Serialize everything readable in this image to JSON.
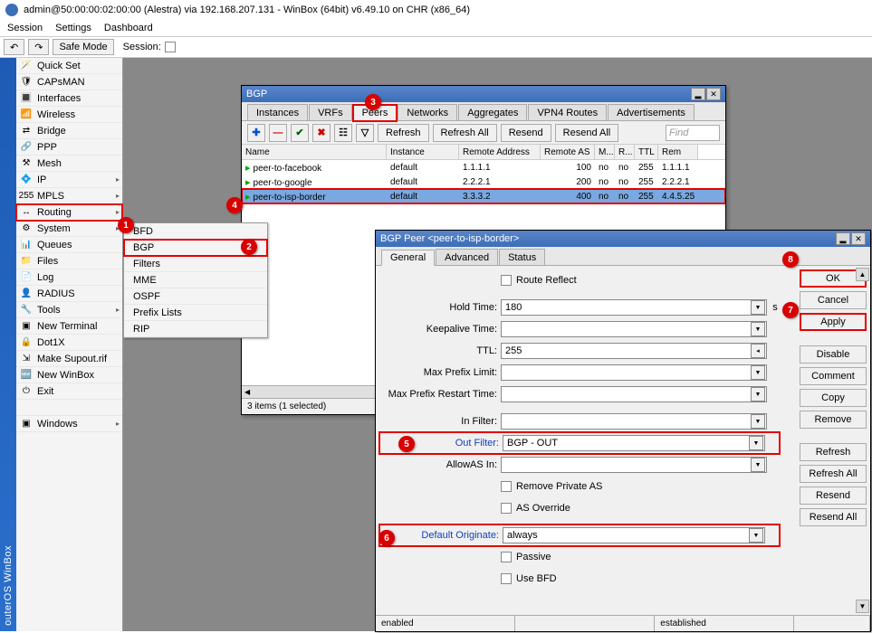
{
  "title": "admin@50:00:00:02:00:00 (Alestra) via 192.168.207.131 - WinBox (64bit) v6.49.10 on CHR (x86_64)",
  "menu": {
    "session": "Session",
    "settings": "Settings",
    "dashboard": "Dashboard"
  },
  "tb": {
    "safe": "Safe Mode",
    "session_lbl": "Session:"
  },
  "leftstrip": "outerOS  WinBox",
  "sidebar": [
    {
      "i": "🪄",
      "l": "Quick Set",
      "a": 0
    },
    {
      "i": "🛡",
      "l": "CAPsMAN",
      "a": 0
    },
    {
      "i": "🔳",
      "l": "Interfaces",
      "a": 0
    },
    {
      "i": "📶",
      "l": "Wireless",
      "a": 0
    },
    {
      "i": "⇄",
      "l": "Bridge",
      "a": 0
    },
    {
      "i": "🔗",
      "l": "PPP",
      "a": 0
    },
    {
      "i": "⚒",
      "l": "Mesh",
      "a": 0
    },
    {
      "i": "💠",
      "l": "IP",
      "a": 1
    },
    {
      "i": "255",
      "l": "MPLS",
      "a": 1
    },
    {
      "i": "↔",
      "l": "Routing",
      "a": 1,
      "hl": 1
    },
    {
      "i": "⚙",
      "l": "System",
      "a": 1
    },
    {
      "i": "📊",
      "l": "Queues",
      "a": 0
    },
    {
      "i": "📁",
      "l": "Files",
      "a": 0
    },
    {
      "i": "📄",
      "l": "Log",
      "a": 0
    },
    {
      "i": "👤",
      "l": "RADIUS",
      "a": 0
    },
    {
      "i": "🔧",
      "l": "Tools",
      "a": 1
    },
    {
      "i": "▣",
      "l": "New Terminal",
      "a": 0
    },
    {
      "i": "🔒",
      "l": "Dot1X",
      "a": 0
    },
    {
      "i": "⇲",
      "l": "Make Supout.rif",
      "a": 0
    },
    {
      "i": "🆕",
      "l": "New WinBox",
      "a": 0
    },
    {
      "i": "⏻",
      "l": "Exit",
      "a": 0
    },
    {
      "i": "",
      "l": "",
      "a": 0
    },
    {
      "i": "▣",
      "l": "Windows",
      "a": 1
    }
  ],
  "submenu": [
    {
      "l": "BFD"
    },
    {
      "l": "BGP",
      "hl": 1
    },
    {
      "l": "Filters"
    },
    {
      "l": "MME"
    },
    {
      "l": "OSPF"
    },
    {
      "l": "Prefix Lists"
    },
    {
      "l": "RIP"
    }
  ],
  "bgp": {
    "title": "BGP",
    "tabs": [
      "Instances",
      "VRFs",
      "Peers",
      "Networks",
      "Aggregates",
      "VPN4 Routes",
      "Advertisements"
    ],
    "active_tab": 2,
    "tb": {
      "refresh": "Refresh",
      "refresh_all": "Refresh All",
      "resend": "Resend",
      "resend_all": "Resend All"
    },
    "find": "Find",
    "cols": [
      "Name",
      "Instance",
      "Remote Address",
      "Remote AS",
      "M...",
      "R...",
      "TTL",
      "Rem"
    ],
    "cw": [
      160,
      80,
      90,
      60,
      22,
      22,
      26,
      44
    ],
    "rows": [
      {
        "c": [
          "peer-to-facebook",
          "default",
          "1.1.1.1",
          "100",
          "no",
          "no",
          "255",
          "1.1.1.1"
        ]
      },
      {
        "c": [
          "peer-to-google",
          "default",
          "2.2.2.1",
          "200",
          "no",
          "no",
          "255",
          "2.2.2.1"
        ]
      },
      {
        "c": [
          "peer-to-isp-border",
          "default",
          "3.3.3.2",
          "400",
          "no",
          "no",
          "255",
          "4.4.5.25"
        ],
        "sel": 1,
        "hl": 1
      }
    ],
    "status": "3 items (1 selected)"
  },
  "peer": {
    "title": "BGP Peer <peer-to-isp-border>",
    "tabs": [
      "General",
      "Advanced",
      "Status"
    ],
    "active_tab": 0,
    "fields": {
      "route_reflect": "Route Reflect",
      "hold_time_lbl": "Hold Time:",
      "hold_time": "180",
      "hold_unit": "s",
      "keepalive_lbl": "Keepalive Time:",
      "keepalive": "",
      "ttl_lbl": "TTL:",
      "ttl": "255",
      "max_prefix_lbl": "Max Prefix Limit:",
      "max_prefix": "",
      "max_restart_lbl": "Max Prefix Restart Time:",
      "max_restart": "",
      "in_filter_lbl": "In Filter:",
      "in_filter": "",
      "out_filter_lbl": "Out Filter:",
      "out_filter": "BGP - OUT",
      "allow_as_lbl": "AllowAS In:",
      "allow_as": "",
      "remove_private": "Remove Private AS",
      "as_override": "AS Override",
      "def_orig_lbl": "Default Originate:",
      "def_orig": "always",
      "passive": "Passive",
      "use_bfd": "Use BFD"
    },
    "buttons": [
      "OK",
      "Cancel",
      "Apply",
      "Disable",
      "Comment",
      "Copy",
      "Remove",
      "Refresh",
      "Refresh All",
      "Resend",
      "Resend All"
    ],
    "status": {
      "l": "enabled",
      "r": "established"
    }
  },
  "badges": {
    "1": "1",
    "2": "2",
    "3": "3",
    "4": "4",
    "5": "5",
    "6": "6",
    "7": "7",
    "8": "8"
  }
}
